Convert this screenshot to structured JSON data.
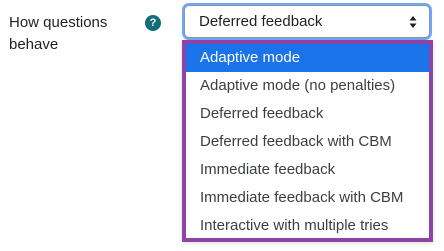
{
  "field": {
    "label": "How questions behave",
    "help_icon": "question-mark-icon",
    "help_glyph": "?"
  },
  "select": {
    "value": "Deferred feedback",
    "arrow_icon": "up-down-arrows-icon"
  },
  "dropdown": {
    "highlighted_index": 0,
    "options": [
      {
        "label": "Adaptive mode"
      },
      {
        "label": "Adaptive mode (no penalties)"
      },
      {
        "label": "Deferred feedback"
      },
      {
        "label": "Deferred feedback with CBM"
      },
      {
        "label": "Immediate feedback"
      },
      {
        "label": "Immediate feedback with CBM"
      },
      {
        "label": "Interactive with multiple tries"
      }
    ]
  },
  "colors": {
    "highlight": "#1a73e8",
    "dropdown_border": "#8e44a6",
    "help_icon_bg": "#0f6e7a",
    "focus_ring": "#6ea8fe"
  }
}
